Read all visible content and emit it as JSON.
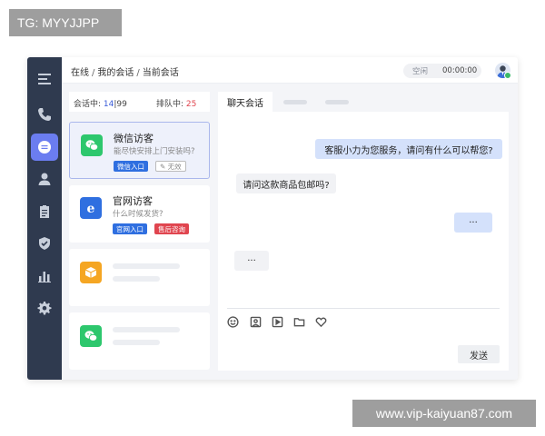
{
  "watermarks": {
    "top": "TG: MYYJJPP",
    "bottom": "www.vip-kaiyuan87.com"
  },
  "rail": {
    "icons": [
      "menu-icon",
      "phone-icon",
      "chat-icon",
      "user-icon",
      "clipboard-icon",
      "shield-icon",
      "bar-chart-icon",
      "gear-icon"
    ],
    "active": "chat-icon"
  },
  "topbar": {
    "breadcrumb": [
      "在线",
      "我的会话",
      "当前会话"
    ],
    "separator": "/",
    "status": "空闲",
    "timer": "00:00:00"
  },
  "counts": {
    "in_session_label": "会话中:",
    "in_session_value": "14",
    "in_session_total": "99",
    "queue_label": "排队中:",
    "queue_value": "25"
  },
  "cards": [
    {
      "title": "微信访客",
      "subtitle": "能尽快安排上门安装吗?",
      "tags": [
        "微信入口",
        "无效"
      ],
      "icon": "wechat-icon"
    },
    {
      "title": "官网访客",
      "subtitle": "什么时候发货?",
      "tags": [
        "官网入口",
        "售后咨询"
      ],
      "icon": "ie-icon"
    },
    {
      "icon": "box-icon"
    },
    {
      "icon": "wechat-icon"
    }
  ],
  "chat": {
    "tab_active": "聊天会话",
    "messages": [
      {
        "side": "out",
        "text": "客服小力为您服务，请问有什么可以帮您?"
      },
      {
        "side": "in",
        "text": "请问这款商品包邮吗?"
      },
      {
        "side": "out",
        "text": "···"
      },
      {
        "side": "in",
        "text": "···"
      }
    ],
    "toolbar_icons": [
      "emoji-icon",
      "image-icon",
      "video-icon",
      "folder-icon",
      "heart-icon"
    ],
    "send_label": "发送"
  },
  "colors": {
    "rail_bg": "#2f3a4f",
    "accent": "#6b7df0",
    "tag_blue": "#2f6fe0",
    "tag_red": "#e0454f",
    "bubble_out": "#d4e1fb",
    "wechat_green": "#2dc76d",
    "orange": "#f5a623"
  }
}
